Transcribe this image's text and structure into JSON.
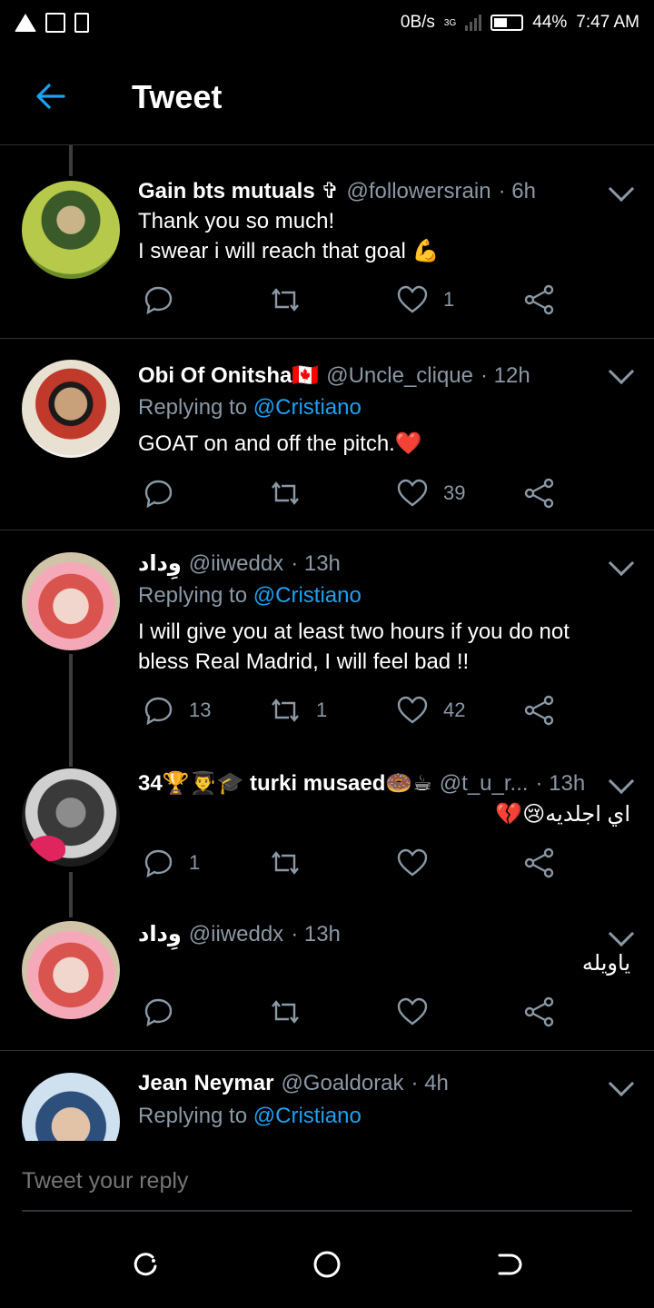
{
  "status": {
    "speed": "0B/s",
    "network": "3G",
    "battery": "44%",
    "time": "7:47 AM"
  },
  "header": {
    "title": "Tweet"
  },
  "tweets": [
    {
      "name": "Gain bts mutuals ✞",
      "handle": "@followersrain",
      "time": "· 6h",
      "reply_prefix": "",
      "reply_to": "",
      "text_lines": [
        "Thank you so much!",
        "I swear i will reach that goal 💪"
      ],
      "replies": "",
      "retweets": "",
      "likes": "1"
    },
    {
      "name": "Obi Of Onitsha🇨🇦",
      "handle": "@Uncle_clique",
      "time": "· 12h",
      "reply_prefix": "Replying to",
      "reply_to": "@Cristiano",
      "text_lines": [
        "GOAT on and off the pitch.❤️"
      ],
      "replies": "",
      "retweets": "",
      "likes": "39"
    },
    {
      "name": "وِداد",
      "handle": "@iiweddx",
      "time": "· 13h",
      "reply_prefix": "Replying to",
      "reply_to": "@Cristiano",
      "text_lines": [
        "I will give you at least two hours if you do not",
        "bless Real Madrid, I will feel bad !!"
      ],
      "replies": "13",
      "retweets": "1",
      "likes": "42"
    },
    {
      "name": "34🏆👨‍🎓🎓 turki musaed🍩☕",
      "handle": "@t_u_r...",
      "time": "· 13h",
      "reply_prefix": "",
      "reply_to": "",
      "text_lines": [
        "اي اجلديه😢💔"
      ],
      "replies": "1",
      "retweets": "",
      "likes": ""
    },
    {
      "name": "وِداد",
      "handle": "@iiweddx",
      "time": "· 13h",
      "reply_prefix": "",
      "reply_to": "",
      "text_lines": [
        "ياويله"
      ],
      "replies": "",
      "retweets": "",
      "likes": ""
    },
    {
      "name": "Jean Neymar",
      "handle": "@Goaldorak",
      "time": "· 4h",
      "reply_prefix": "Replying to",
      "reply_to": "@Cristiano",
      "text_lines": [],
      "replies": "",
      "retweets": "",
      "likes": ""
    }
  ],
  "reply_bar": {
    "placeholder": "Tweet your reply"
  },
  "icons": {
    "accent": "#1da1f2",
    "muted": "#8b98a5",
    "divider": "#2f3336"
  }
}
